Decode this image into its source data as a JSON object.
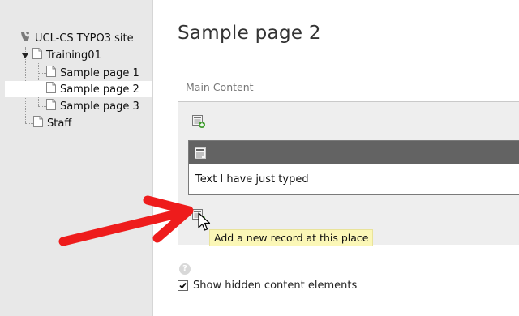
{
  "page_tree": {
    "site_name": "UCL-CS TYPO3 site",
    "items": [
      {
        "label": "Training01",
        "expanded": true
      },
      {
        "label": "Sample page 1"
      },
      {
        "label": "Sample page 2",
        "selected": true
      },
      {
        "label": "Sample page 3"
      },
      {
        "label": "Staff"
      }
    ]
  },
  "main": {
    "page_title": "Sample page 2",
    "column_label": "Main Content",
    "content_element": {
      "body_text": "Text I have just typed"
    },
    "tooltip": "Add a new record at this place",
    "show_hidden": {
      "label": "Show hidden content elements",
      "checked": true
    }
  },
  "icons": {
    "site_logo": "typo3-logo-icon",
    "page": "page-icon",
    "new_record": "new-record-icon",
    "content_type": "text-element-icon",
    "help": "help-icon",
    "annotation": "red-arrow-annotation",
    "cursor": "mouse-pointer-icon"
  },
  "colors": {
    "tree_background": "#e8e8e8",
    "column_background": "#eeeeee",
    "element_header": "#636363",
    "tooltip_background": "#fbf7b7",
    "arrow": "#ee1c1c",
    "add_icon_green": "#3c9a2a"
  }
}
